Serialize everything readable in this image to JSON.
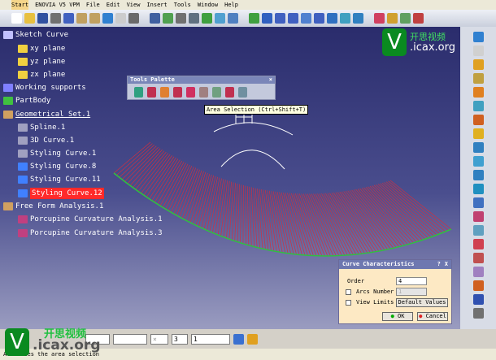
{
  "menu": [
    "Start",
    "ENOVIA V5 VPM",
    "File",
    "Edit",
    "View",
    "Insert",
    "Tools",
    "Window",
    "Help"
  ],
  "tree": [
    {
      "label": "Sketch Curve",
      "indent": 0,
      "color": "#c0c0ff"
    },
    {
      "label": "xy plane",
      "indent": 1,
      "color": "#f0d040"
    },
    {
      "label": "yz plane",
      "indent": 1,
      "color": "#f0d040"
    },
    {
      "label": "zx plane",
      "indent": 1,
      "color": "#f0d040"
    },
    {
      "label": "Working supports",
      "indent": 0,
      "color": "#8080ff"
    },
    {
      "label": "PartBody",
      "indent": 0,
      "color": "#40c040"
    },
    {
      "label": "Geometrical Set.1",
      "indent": 0,
      "color": "#d0a060",
      "underline": true
    },
    {
      "label": "Spline.1",
      "indent": 1,
      "color": "#a0a0c0"
    },
    {
      "label": "3D Curve.1",
      "indent": 1,
      "color": "#a0a0c0"
    },
    {
      "label": "Styling Curve.1",
      "indent": 1,
      "color": "#a0a0c0"
    },
    {
      "label": "Styling Curve.8",
      "indent": 1,
      "color": "#4080ff"
    },
    {
      "label": "Styling Curve.11",
      "indent": 1,
      "color": "#4080ff"
    },
    {
      "label": "Styling Curve.12",
      "indent": 1,
      "color": "#4080ff",
      "highlight": true
    },
    {
      "label": "Free Form Analysis.1",
      "indent": 0,
      "color": "#d0a060"
    },
    {
      "label": "Porcupine Curvature Analysis.1",
      "indent": 1,
      "color": "#c04080"
    },
    {
      "label": "Porcupine Curvature Analysis.3",
      "indent": 1,
      "color": "#c04080"
    }
  ],
  "palette": {
    "title": "Tools Palette"
  },
  "tooltip": "Area Selection (Ctrl+Shift+T)",
  "dialog": {
    "title": "Curve Characteristics",
    "help": "?",
    "close": "X",
    "order_label": "Order",
    "order_value": "4",
    "arcs_label": "Arcs Number",
    "arcs_value": "1",
    "view_limits_label": "View Limits",
    "default_values": "Default Values",
    "ok": "OK",
    "cancel": "Cancel"
  },
  "bottombar": {
    "sel1": "",
    "sel2": "",
    "sel3": "3",
    "sel4": "1"
  },
  "status": "Activates the area selection",
  "watermark": {
    "brand": "开思视频",
    "site": ".icax.org"
  },
  "colors": {
    "mesh": "#d03040",
    "edge": "#30c040"
  }
}
